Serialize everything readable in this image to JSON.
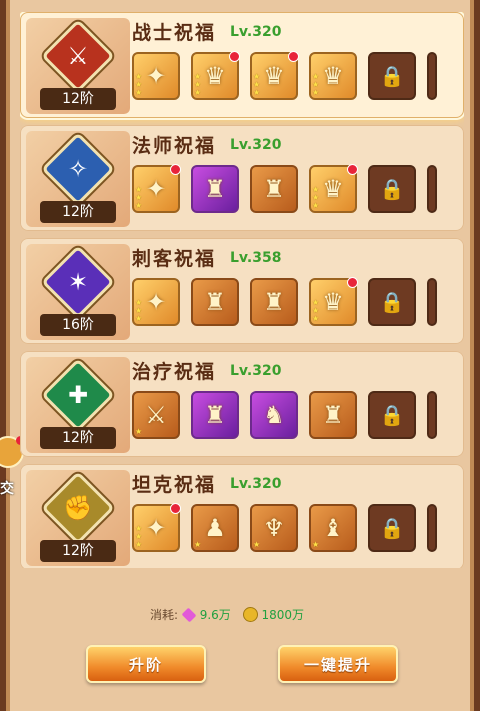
{
  "blessings": [
    {
      "title": "战士祝福",
      "level": "Lv.320",
      "tier": "12阶",
      "emblem_color": "#b8321e",
      "emblem_icon": "sword-emblem-icon",
      "emblem_glyph": "⚔",
      "slots": [
        {
          "quality": "gold",
          "icon": "staff",
          "glyph": "✦",
          "stars": 3,
          "dot": false
        },
        {
          "quality": "gold",
          "icon": "armor",
          "glyph": "♛",
          "stars": 3,
          "dot": true
        },
        {
          "quality": "gold",
          "icon": "armor",
          "glyph": "♛",
          "stars": 3,
          "dot": true
        },
        {
          "quality": "gold",
          "icon": "armor",
          "glyph": "♛",
          "stars": 3,
          "dot": false
        },
        {
          "quality": "locked",
          "icon": "lock",
          "glyph": "🔒",
          "stars": 0,
          "dot": false
        }
      ]
    },
    {
      "title": "法师祝福",
      "level": "Lv.320",
      "tier": "12阶",
      "emblem_color": "#2c5fb0",
      "emblem_icon": "mage-emblem-icon",
      "emblem_glyph": "✧",
      "slots": [
        {
          "quality": "gold",
          "icon": "staff",
          "glyph": "✦",
          "stars": 3,
          "dot": true
        },
        {
          "quality": "purple",
          "icon": "armor",
          "glyph": "♜",
          "stars": 0,
          "dot": false
        },
        {
          "quality": "orange",
          "icon": "armor",
          "glyph": "♜",
          "stars": 0,
          "dot": false
        },
        {
          "quality": "gold",
          "icon": "armor",
          "glyph": "♛",
          "stars": 3,
          "dot": true
        },
        {
          "quality": "locked",
          "icon": "lock",
          "glyph": "🔒",
          "stars": 0,
          "dot": false
        }
      ]
    },
    {
      "title": "刺客祝福",
      "level": "Lv.358",
      "tier": "16阶",
      "emblem_color": "#5a2fb8",
      "emblem_icon": "shuriken-emblem-icon",
      "emblem_glyph": "✶",
      "slots": [
        {
          "quality": "gold",
          "icon": "staff",
          "glyph": "✦",
          "stars": 3,
          "dot": false
        },
        {
          "quality": "orange",
          "icon": "armor",
          "glyph": "♜",
          "stars": 0,
          "dot": false
        },
        {
          "quality": "orange",
          "icon": "armor",
          "glyph": "♜",
          "stars": 0,
          "dot": false
        },
        {
          "quality": "gold",
          "icon": "armor",
          "glyph": "♛",
          "stars": 3,
          "dot": true
        },
        {
          "quality": "locked",
          "icon": "lock",
          "glyph": "🔒",
          "stars": 0,
          "dot": false
        }
      ]
    },
    {
      "title": "治疗祝福",
      "level": "Lv.320",
      "tier": "12阶",
      "emblem_color": "#1f8a4a",
      "emblem_icon": "cross-emblem-icon",
      "emblem_glyph": "✚",
      "slots": [
        {
          "quality": "orange",
          "icon": "sword",
          "glyph": "⚔",
          "stars": 1,
          "dot": false
        },
        {
          "quality": "purple",
          "icon": "armor",
          "glyph": "♜",
          "stars": 0,
          "dot": false
        },
        {
          "quality": "purple",
          "icon": "helmet",
          "glyph": "♞",
          "stars": 0,
          "dot": false
        },
        {
          "quality": "orange",
          "icon": "armor",
          "glyph": "♜",
          "stars": 0,
          "dot": false
        },
        {
          "quality": "locked",
          "icon": "lock",
          "glyph": "🔒",
          "stars": 0,
          "dot": false
        }
      ]
    },
    {
      "title": "坦克祝福",
      "level": "Lv.320",
      "tier": "12阶",
      "emblem_color": "#a88a2a",
      "emblem_icon": "fist-emblem-icon",
      "emblem_glyph": "✊",
      "slots": [
        {
          "quality": "gold",
          "icon": "staff",
          "glyph": "✦",
          "stars": 3,
          "dot": true
        },
        {
          "quality": "orange",
          "icon": "robe",
          "glyph": "♟",
          "stars": 1,
          "dot": false
        },
        {
          "quality": "orange",
          "icon": "amulet",
          "glyph": "♆",
          "stars": 1,
          "dot": false
        },
        {
          "quality": "orange",
          "icon": "boots",
          "glyph": "♝",
          "stars": 1,
          "dot": false
        },
        {
          "quality": "locked",
          "icon": "lock",
          "glyph": "🔒",
          "stars": 0,
          "dot": false
        }
      ]
    }
  ],
  "cost": {
    "label": "消耗:",
    "gem_amount": "9.6万",
    "coin_amount": "1800万"
  },
  "buttons": {
    "upgrade": "升阶",
    "upgrade_all": "一键提升"
  },
  "side_label": "交"
}
